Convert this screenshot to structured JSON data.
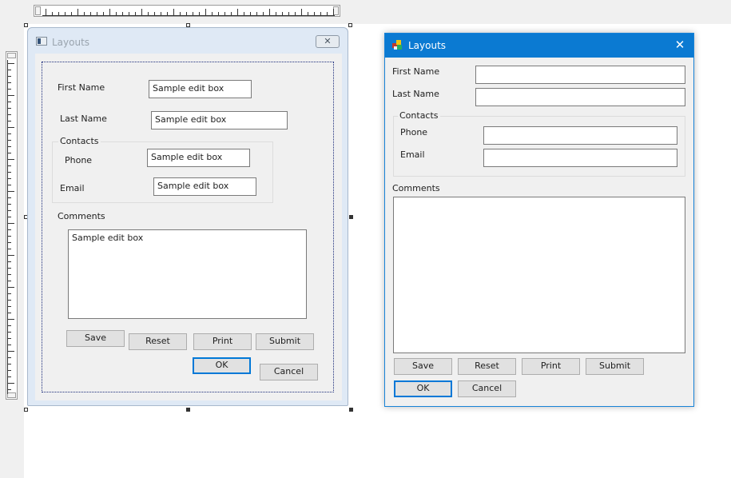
{
  "designer": {
    "window_title": "Layouts",
    "close_glyph": "✕",
    "first_name_label": "First Name",
    "first_name_value": "Sample edit box",
    "last_name_label": "Last Name",
    "last_name_value": "Sample edit box",
    "contacts_label": "Contacts",
    "phone_label": "Phone",
    "phone_value": "Sample edit box",
    "email_label": "Email",
    "email_value": "Sample edit box",
    "comments_label": "Comments",
    "comments_value": "Sample edit box",
    "buttons": {
      "save": "Save",
      "reset": "Reset",
      "print": "Print",
      "submit": "Submit",
      "ok": "OK",
      "cancel": "Cancel"
    }
  },
  "preview": {
    "window_title": "Layouts",
    "close_glyph": "✕",
    "first_name_label": "First Name",
    "first_name_value": "",
    "last_name_label": "Last Name",
    "last_name_value": "",
    "contacts_label": "Contacts",
    "phone_label": "Phone",
    "phone_value": "",
    "email_label": "Email",
    "email_value": "",
    "comments_label": "Comments",
    "comments_value": "",
    "buttons": {
      "save": "Save",
      "reset": "Reset",
      "print": "Print",
      "submit": "Submit",
      "ok": "OK",
      "cancel": "Cancel"
    }
  },
  "icons": {
    "designer_app": "dialog-resource-icon",
    "preview_app": "app-cubes-icon",
    "close": "close-icon"
  },
  "colors": {
    "titlebar_active": "#0b7ad2",
    "default_button_border": "#0078d7",
    "designer_frame": "#dfe9f5"
  }
}
